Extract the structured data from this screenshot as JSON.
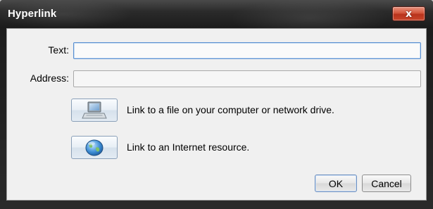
{
  "window": {
    "title": "Hyperlink",
    "close_glyph": "x"
  },
  "form": {
    "text_label": "Text:",
    "text_value": "",
    "address_label": "Address:",
    "address_value": ""
  },
  "links": [
    {
      "icon": "computer-icon",
      "label": "Link to a file on your computer or network drive."
    },
    {
      "icon": "globe-icon",
      "label": "Link to an Internet resource."
    }
  ],
  "buttons": {
    "ok": "OK",
    "cancel": "Cancel"
  },
  "colors": {
    "titlebar": "#1c1c1c",
    "close_button": "#c9452a",
    "dialog_background": "#f0f0f0",
    "focus_border": "#5a8fd0"
  }
}
